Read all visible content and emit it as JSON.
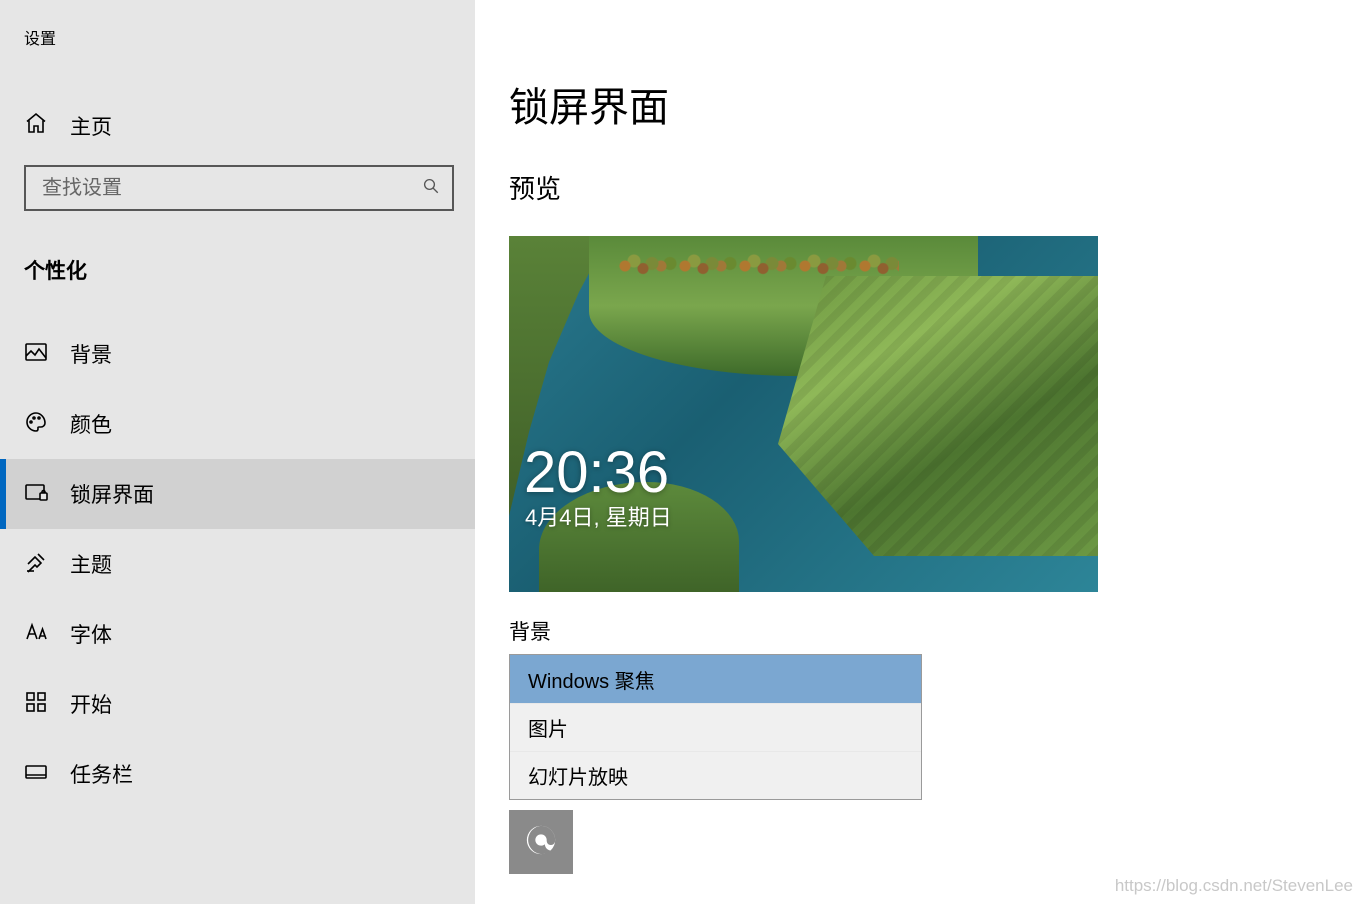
{
  "app_title": "设置",
  "home_label": "主页",
  "search": {
    "placeholder": "查找设置"
  },
  "category": "个性化",
  "nav": {
    "items": [
      {
        "label": "背景"
      },
      {
        "label": "颜色"
      },
      {
        "label": "锁屏界面"
      },
      {
        "label": "主题"
      },
      {
        "label": "字体"
      },
      {
        "label": "开始"
      },
      {
        "label": "任务栏"
      }
    ],
    "active_index": 2
  },
  "page": {
    "title": "锁屏界面",
    "preview_label": "预览",
    "preview": {
      "time": "20:36",
      "date": "4月4日, 星期日"
    },
    "background_label": "背景",
    "background_options": [
      "Windows 聚焦",
      "图片",
      "幻灯片放映"
    ],
    "background_selected_index": 0,
    "status_app": {
      "icon": "edge-icon"
    }
  },
  "watermark": "https://blog.csdn.net/StevenLee"
}
